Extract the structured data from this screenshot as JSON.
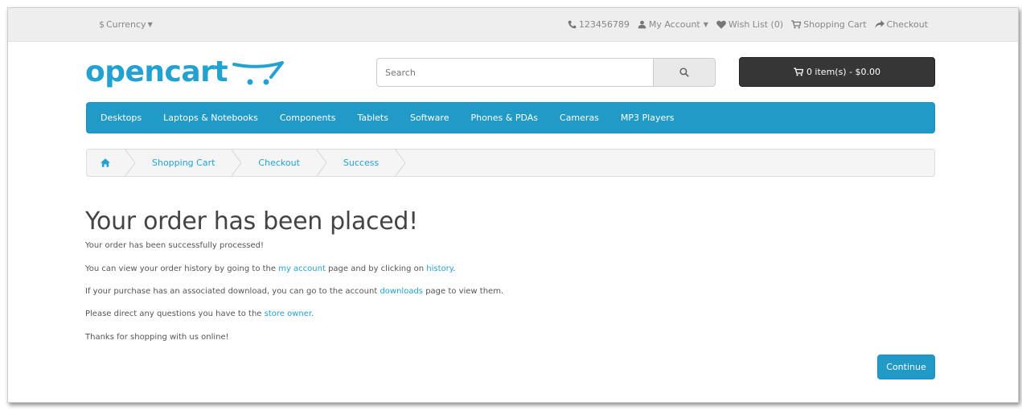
{
  "topbar": {
    "currency_symbol": "$",
    "currency_label": "Currency",
    "phone": "123456789",
    "my_account": "My Account",
    "wish_list": "Wish List (0)",
    "shopping_cart": "Shopping Cart",
    "checkout": "Checkout"
  },
  "header": {
    "logo_text": "opencart",
    "search_placeholder": "Search",
    "cart_summary": "0 item(s) - $0.00"
  },
  "menu": {
    "items": [
      "Desktops",
      "Laptops & Notebooks",
      "Components",
      "Tablets",
      "Software",
      "Phones & PDAs",
      "Cameras",
      "MP3 Players"
    ]
  },
  "breadcrumb": {
    "items": [
      "Shopping Cart",
      "Checkout",
      "Success"
    ]
  },
  "content": {
    "title": "Your order has been placed!",
    "line1": "Your order has been successfully processed!",
    "line2_a": "You can view your order history by going to the ",
    "line2_link1": "my account",
    "line2_b": " page and by clicking on ",
    "line2_link2": "history",
    "line2_c": ".",
    "line3_a": "If your purchase has an associated download, you can go to the account ",
    "line3_link": "downloads",
    "line3_b": " page to view them.",
    "line4_a": "Please direct any questions you have to the ",
    "line4_link": "store owner",
    "line4_b": ".",
    "line5": "Thanks for shopping with us online!",
    "continue_label": "Continue"
  },
  "colors": {
    "brand_blue": "#229ac8",
    "link_blue": "#23a1d1",
    "cart_dark": "#363636"
  }
}
